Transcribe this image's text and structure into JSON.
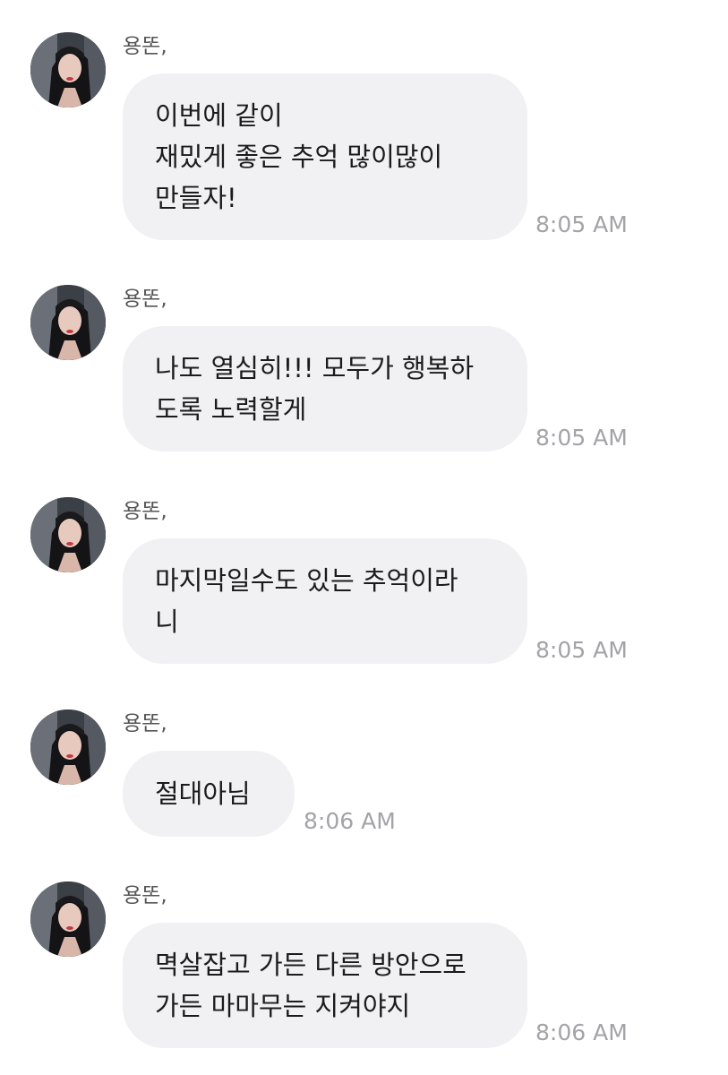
{
  "colors": {
    "bubble_bg": "#f1f1f4",
    "message_text": "#1b1b1b",
    "sender_text": "#555555",
    "time_text": "#a3a3a8"
  },
  "messages": [
    {
      "sender": "용똔,",
      "lines": [
        "이번에 같이",
        "재밌게 좋은 추억 많이많이",
        "만들자!"
      ],
      "time": "8:05 AM",
      "avatar_icon": "profile-photo"
    },
    {
      "sender": "용똔,",
      "lines": [
        "나도 열심히!!! 모두가 행복하",
        "도록 노력할게"
      ],
      "time": "8:05 AM",
      "avatar_icon": "profile-photo"
    },
    {
      "sender": "용똔,",
      "lines": [
        "마지막일수도 있는 추억이라",
        "니"
      ],
      "time": "8:05 AM",
      "avatar_icon": "profile-photo"
    },
    {
      "sender": "용똔,",
      "lines": [
        "절대아님"
      ],
      "time": "8:06 AM",
      "avatar_icon": "profile-photo"
    },
    {
      "sender": "용똔,",
      "lines": [
        "멱살잡고 가든 다른 방안으로",
        "가든 마마무는 지켜야지"
      ],
      "time": "8:06 AM",
      "avatar_icon": "profile-photo"
    }
  ]
}
